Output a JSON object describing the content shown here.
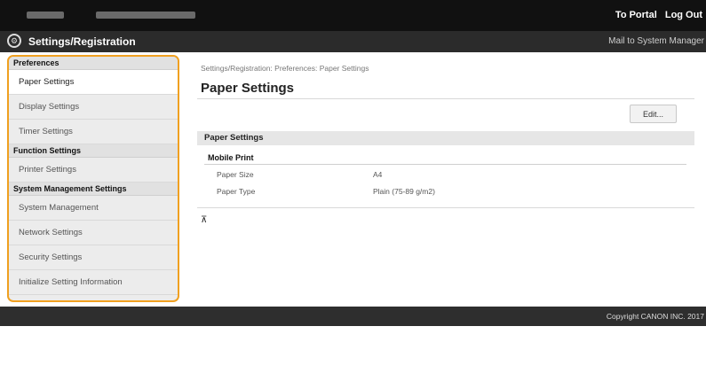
{
  "topbar": {
    "portal_link": "To Portal",
    "logout_link": "Log Out"
  },
  "header": {
    "title": "Settings/Registration",
    "mail_link": "Mail to System Manager"
  },
  "sidebar": {
    "sections": [
      {
        "heading": "Preferences",
        "items": [
          "Paper Settings",
          "Display Settings",
          "Timer Settings"
        ]
      },
      {
        "heading": "Function Settings",
        "items": [
          "Printer Settings"
        ]
      },
      {
        "heading": "System Management Settings",
        "items": [
          "System Management",
          "Network Settings",
          "Security Settings",
          "Initialize Setting Information"
        ]
      }
    ],
    "active_item": "Paper Settings"
  },
  "main": {
    "breadcrumb": "Settings/Registration: Preferences: Paper Settings",
    "title": "Paper Settings",
    "edit_button": "Edit...",
    "section_title": "Paper Settings",
    "subsection_title": "Mobile Print",
    "rows": [
      {
        "label": "Paper Size",
        "value": "A4"
      },
      {
        "label": "Paper Type",
        "value": "Plain (75-89 g/m2)"
      }
    ],
    "top_icon": "to-top-icon"
  },
  "footer": {
    "copyright": "Copyright CANON INC. 2017"
  },
  "colors": {
    "highlight_border": "#f0a020",
    "topbar": "#111111",
    "footer": "#2e2e2e"
  }
}
